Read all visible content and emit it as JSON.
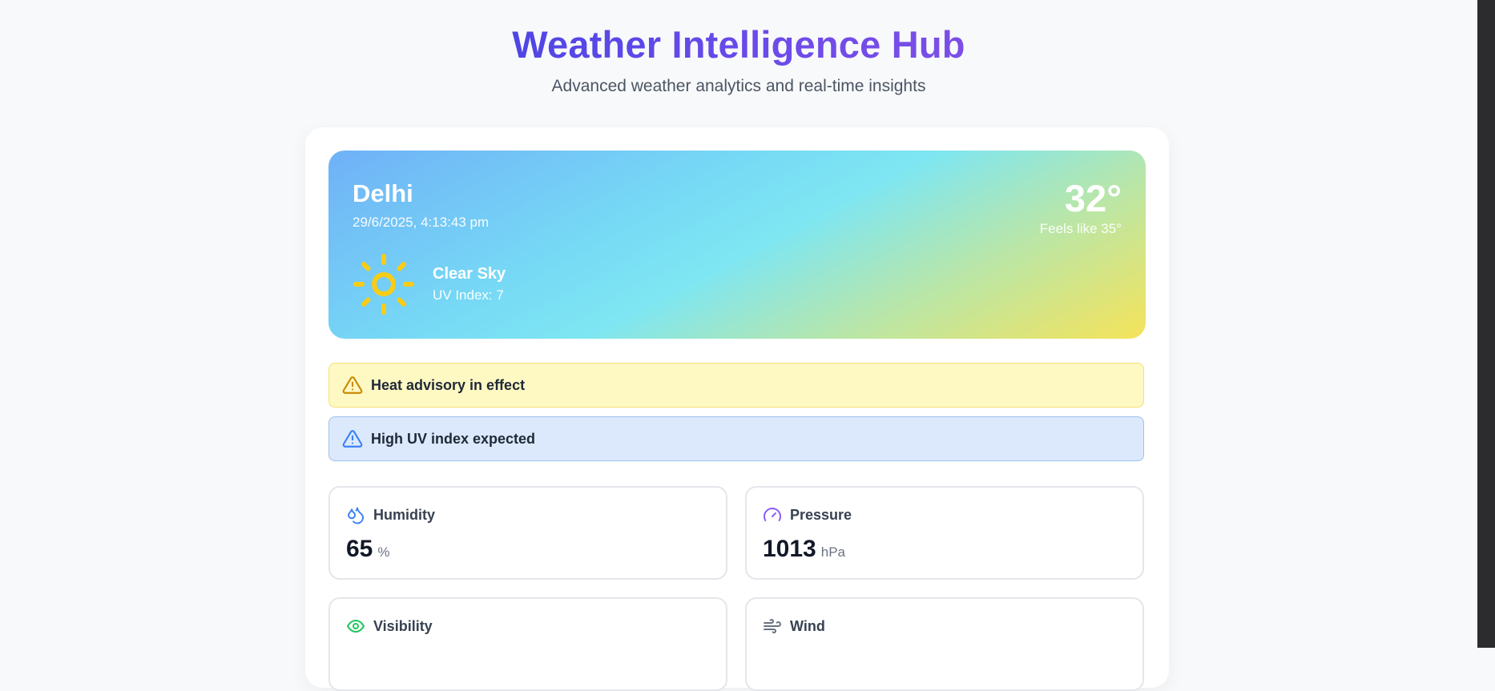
{
  "header": {
    "title": "Weather Intelligence Hub",
    "subtitle": "Advanced weather analytics and real-time insights"
  },
  "current": {
    "city": "Delhi",
    "datetime": "29/6/2025, 4:13:43 pm",
    "temperature": "32°",
    "feels_like": "Feels like 35°",
    "condition": "Clear Sky",
    "uv_index": "UV Index: 7",
    "icon": "sun-icon"
  },
  "alerts": [
    {
      "text": "Heat advisory in effect",
      "icon": "warning-triangle-icon",
      "color": "#eab308"
    },
    {
      "text": "High UV index expected",
      "icon": "warning-triangle-icon",
      "color": "#3b82f6"
    }
  ],
  "stats": {
    "humidity": {
      "label": "Humidity",
      "value": "65",
      "unit": "%",
      "icon": "droplets-icon",
      "color": "#3b82f6"
    },
    "pressure": {
      "label": "Pressure",
      "value": "1013",
      "unit": "hPa",
      "icon": "gauge-icon",
      "color": "#8b5cf6"
    },
    "visibility": {
      "label": "Visibility",
      "icon": "eye-icon",
      "color": "#22c55e"
    },
    "wind": {
      "label": "Wind",
      "icon": "wind-icon",
      "color": "#6b7280"
    }
  }
}
